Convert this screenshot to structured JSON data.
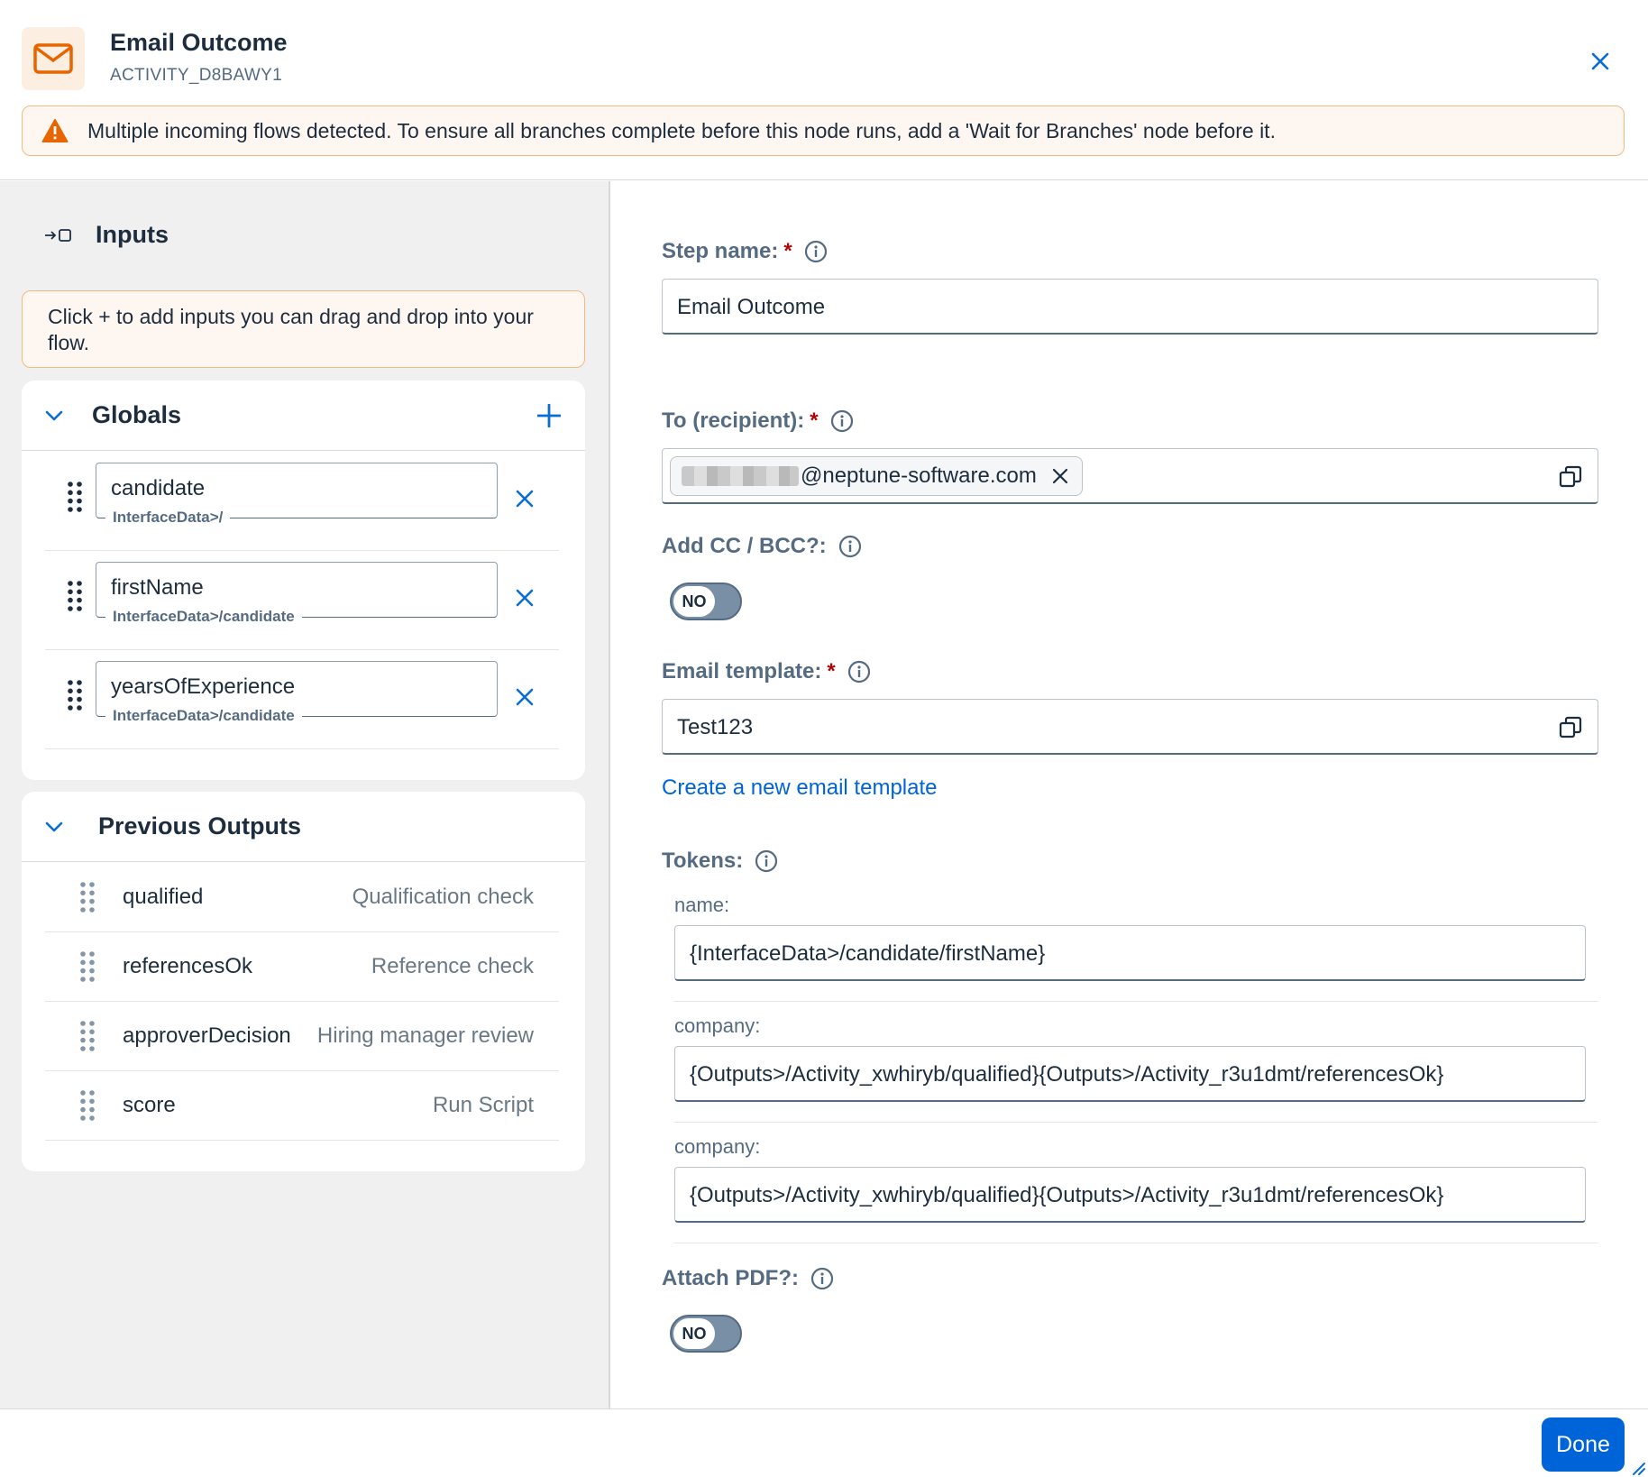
{
  "header": {
    "title": "Email Outcome",
    "subtitle": "ACTIVITY_D8BAWY1",
    "icon": "envelope-icon",
    "accent_color": "#e76500"
  },
  "warning": {
    "text": "Multiple incoming flows detected. To ensure all branches complete before this node runs, add a 'Wait for Branches' node before it.",
    "icon": "warning-triangle-icon"
  },
  "inputs": {
    "title": "Inputs",
    "hint": "Click + to add inputs you can drag and drop into your flow.",
    "globals": {
      "title": "Globals",
      "items": [
        {
          "name": "candidate",
          "path": "InterfaceData>/"
        },
        {
          "name": "firstName",
          "path": "InterfaceData>/candidate"
        },
        {
          "name": "yearsOfExperience",
          "path": "InterfaceData>/candidate"
        }
      ]
    },
    "previous_outputs": {
      "title": "Previous Outputs",
      "items": [
        {
          "name": "qualified",
          "source": "Qualification check"
        },
        {
          "name": "referencesOk",
          "source": "Reference check"
        },
        {
          "name": "approverDecision",
          "source": "Hiring manager review"
        },
        {
          "name": "score",
          "source": "Run Script"
        }
      ]
    }
  },
  "form": {
    "step_name": {
      "label": "Step name:",
      "required": "*",
      "value": "Email Outcome"
    },
    "to": {
      "label": "To (recipient):",
      "required": "*",
      "email_suffix": "@neptune-software.com"
    },
    "cc_bcc": {
      "label": "Add CC / BCC?:",
      "toggle": "NO"
    },
    "email_template": {
      "label": "Email template:",
      "required": "*",
      "value": "Test123"
    },
    "create_template_link": "Create a new email template",
    "tokens": {
      "label": "Tokens:",
      "items": [
        {
          "label": "name:",
          "value": "{InterfaceData>/candidate/firstName}"
        },
        {
          "label": "company:",
          "value": "{Outputs>/Activity_xwhiryb/qualified}{Outputs>/Activity_r3u1dmt/referencesOk}"
        },
        {
          "label": "company:",
          "value": "{Outputs>/Activity_xwhiryb/qualified}{Outputs>/Activity_r3u1dmt/referencesOk}"
        }
      ]
    },
    "attach_pdf": {
      "label": "Attach PDF?:",
      "toggle": "NO"
    }
  },
  "footer": {
    "done_label": "Done"
  },
  "colors": {
    "primary": "#0064d9",
    "warning_bg": "#fef7f1",
    "warning_border": "#f5b982",
    "required": "#aa0808"
  }
}
